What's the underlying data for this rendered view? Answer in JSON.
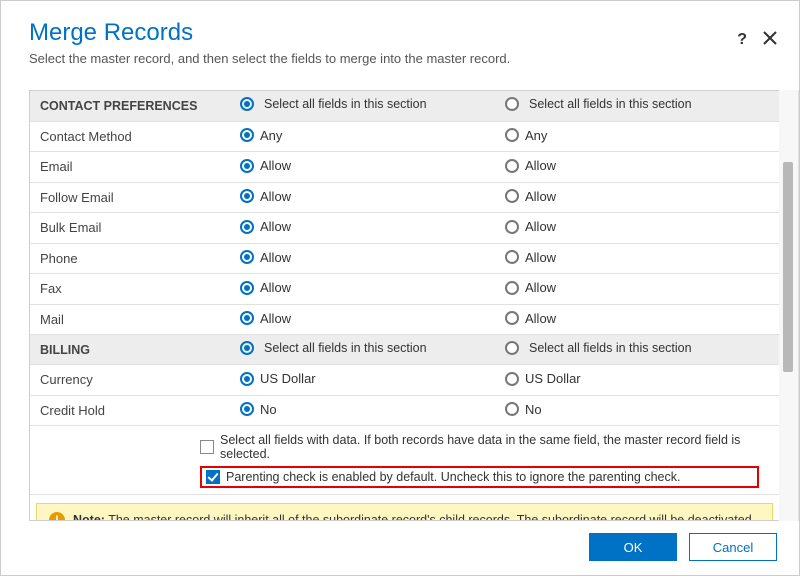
{
  "header": {
    "title": "Merge Records",
    "subtitle": "Select the master record, and then select the fields to merge into the master record."
  },
  "labels": {
    "select_all_section": "Select all fields in this section"
  },
  "sections": [
    {
      "name": "CONTACT PREFERENCES",
      "rows": [
        {
          "label": "Contact Method",
          "a": "Any",
          "b": "Any"
        },
        {
          "label": "Email",
          "a": "Allow",
          "b": "Allow"
        },
        {
          "label": "Follow Email",
          "a": "Allow",
          "b": "Allow"
        },
        {
          "label": "Bulk Email",
          "a": "Allow",
          "b": "Allow"
        },
        {
          "label": "Phone",
          "a": "Allow",
          "b": "Allow"
        },
        {
          "label": "Fax",
          "a": "Allow",
          "b": "Allow"
        },
        {
          "label": "Mail",
          "a": "Allow",
          "b": "Allow"
        }
      ]
    },
    {
      "name": "BILLING",
      "rows": [
        {
          "label": "Currency",
          "a": "US Dollar",
          "b": "US Dollar"
        },
        {
          "label": "Credit Hold",
          "a": "No",
          "b": "No"
        }
      ]
    }
  ],
  "footer_checks": {
    "select_all_data": {
      "checked": false,
      "label": "Select all fields with data. If both records have data in the same field, the master record field is selected."
    },
    "parenting_check": {
      "checked": true,
      "label": "Parenting check is enabled by default. Uncheck this to ignore the parenting check."
    }
  },
  "note": {
    "prefix": "Note:",
    "text": "The master record will inherit all of the subordinate record's child records. The subordinate record will be deactivated."
  },
  "buttons": {
    "ok": "OK",
    "cancel": "Cancel"
  }
}
